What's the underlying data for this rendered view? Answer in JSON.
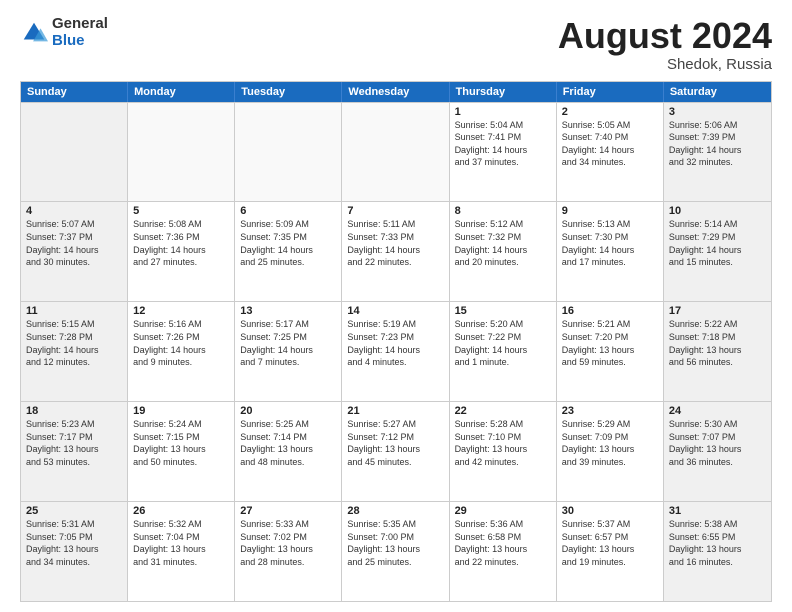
{
  "logo": {
    "general": "General",
    "blue": "Blue"
  },
  "title": "August 2024",
  "location": "Shedok, Russia",
  "days": [
    "Sunday",
    "Monday",
    "Tuesday",
    "Wednesday",
    "Thursday",
    "Friday",
    "Saturday"
  ],
  "rows": [
    [
      {
        "day": "",
        "lines": []
      },
      {
        "day": "",
        "lines": []
      },
      {
        "day": "",
        "lines": []
      },
      {
        "day": "",
        "lines": []
      },
      {
        "day": "1",
        "lines": [
          "Sunrise: 5:04 AM",
          "Sunset: 7:41 PM",
          "Daylight: 14 hours",
          "and 37 minutes."
        ]
      },
      {
        "day": "2",
        "lines": [
          "Sunrise: 5:05 AM",
          "Sunset: 7:40 PM",
          "Daylight: 14 hours",
          "and 34 minutes."
        ]
      },
      {
        "day": "3",
        "lines": [
          "Sunrise: 5:06 AM",
          "Sunset: 7:39 PM",
          "Daylight: 14 hours",
          "and 32 minutes."
        ]
      }
    ],
    [
      {
        "day": "4",
        "lines": [
          "Sunrise: 5:07 AM",
          "Sunset: 7:37 PM",
          "Daylight: 14 hours",
          "and 30 minutes."
        ]
      },
      {
        "day": "5",
        "lines": [
          "Sunrise: 5:08 AM",
          "Sunset: 7:36 PM",
          "Daylight: 14 hours",
          "and 27 minutes."
        ]
      },
      {
        "day": "6",
        "lines": [
          "Sunrise: 5:09 AM",
          "Sunset: 7:35 PM",
          "Daylight: 14 hours",
          "and 25 minutes."
        ]
      },
      {
        "day": "7",
        "lines": [
          "Sunrise: 5:11 AM",
          "Sunset: 7:33 PM",
          "Daylight: 14 hours",
          "and 22 minutes."
        ]
      },
      {
        "day": "8",
        "lines": [
          "Sunrise: 5:12 AM",
          "Sunset: 7:32 PM",
          "Daylight: 14 hours",
          "and 20 minutes."
        ]
      },
      {
        "day": "9",
        "lines": [
          "Sunrise: 5:13 AM",
          "Sunset: 7:30 PM",
          "Daylight: 14 hours",
          "and 17 minutes."
        ]
      },
      {
        "day": "10",
        "lines": [
          "Sunrise: 5:14 AM",
          "Sunset: 7:29 PM",
          "Daylight: 14 hours",
          "and 15 minutes."
        ]
      }
    ],
    [
      {
        "day": "11",
        "lines": [
          "Sunrise: 5:15 AM",
          "Sunset: 7:28 PM",
          "Daylight: 14 hours",
          "and 12 minutes."
        ]
      },
      {
        "day": "12",
        "lines": [
          "Sunrise: 5:16 AM",
          "Sunset: 7:26 PM",
          "Daylight: 14 hours",
          "and 9 minutes."
        ]
      },
      {
        "day": "13",
        "lines": [
          "Sunrise: 5:17 AM",
          "Sunset: 7:25 PM",
          "Daylight: 14 hours",
          "and 7 minutes."
        ]
      },
      {
        "day": "14",
        "lines": [
          "Sunrise: 5:19 AM",
          "Sunset: 7:23 PM",
          "Daylight: 14 hours",
          "and 4 minutes."
        ]
      },
      {
        "day": "15",
        "lines": [
          "Sunrise: 5:20 AM",
          "Sunset: 7:22 PM",
          "Daylight: 14 hours",
          "and 1 minute."
        ]
      },
      {
        "day": "16",
        "lines": [
          "Sunrise: 5:21 AM",
          "Sunset: 7:20 PM",
          "Daylight: 13 hours",
          "and 59 minutes."
        ]
      },
      {
        "day": "17",
        "lines": [
          "Sunrise: 5:22 AM",
          "Sunset: 7:18 PM",
          "Daylight: 13 hours",
          "and 56 minutes."
        ]
      }
    ],
    [
      {
        "day": "18",
        "lines": [
          "Sunrise: 5:23 AM",
          "Sunset: 7:17 PM",
          "Daylight: 13 hours",
          "and 53 minutes."
        ]
      },
      {
        "day": "19",
        "lines": [
          "Sunrise: 5:24 AM",
          "Sunset: 7:15 PM",
          "Daylight: 13 hours",
          "and 50 minutes."
        ]
      },
      {
        "day": "20",
        "lines": [
          "Sunrise: 5:25 AM",
          "Sunset: 7:14 PM",
          "Daylight: 13 hours",
          "and 48 minutes."
        ]
      },
      {
        "day": "21",
        "lines": [
          "Sunrise: 5:27 AM",
          "Sunset: 7:12 PM",
          "Daylight: 13 hours",
          "and 45 minutes."
        ]
      },
      {
        "day": "22",
        "lines": [
          "Sunrise: 5:28 AM",
          "Sunset: 7:10 PM",
          "Daylight: 13 hours",
          "and 42 minutes."
        ]
      },
      {
        "day": "23",
        "lines": [
          "Sunrise: 5:29 AM",
          "Sunset: 7:09 PM",
          "Daylight: 13 hours",
          "and 39 minutes."
        ]
      },
      {
        "day": "24",
        "lines": [
          "Sunrise: 5:30 AM",
          "Sunset: 7:07 PM",
          "Daylight: 13 hours",
          "and 36 minutes."
        ]
      }
    ],
    [
      {
        "day": "25",
        "lines": [
          "Sunrise: 5:31 AM",
          "Sunset: 7:05 PM",
          "Daylight: 13 hours",
          "and 34 minutes."
        ]
      },
      {
        "day": "26",
        "lines": [
          "Sunrise: 5:32 AM",
          "Sunset: 7:04 PM",
          "Daylight: 13 hours",
          "and 31 minutes."
        ]
      },
      {
        "day": "27",
        "lines": [
          "Sunrise: 5:33 AM",
          "Sunset: 7:02 PM",
          "Daylight: 13 hours",
          "and 28 minutes."
        ]
      },
      {
        "day": "28",
        "lines": [
          "Sunrise: 5:35 AM",
          "Sunset: 7:00 PM",
          "Daylight: 13 hours",
          "and 25 minutes."
        ]
      },
      {
        "day": "29",
        "lines": [
          "Sunrise: 5:36 AM",
          "Sunset: 6:58 PM",
          "Daylight: 13 hours",
          "and 22 minutes."
        ]
      },
      {
        "day": "30",
        "lines": [
          "Sunrise: 5:37 AM",
          "Sunset: 6:57 PM",
          "Daylight: 13 hours",
          "and 19 minutes."
        ]
      },
      {
        "day": "31",
        "lines": [
          "Sunrise: 5:38 AM",
          "Sunset: 6:55 PM",
          "Daylight: 13 hours",
          "and 16 minutes."
        ]
      }
    ]
  ]
}
